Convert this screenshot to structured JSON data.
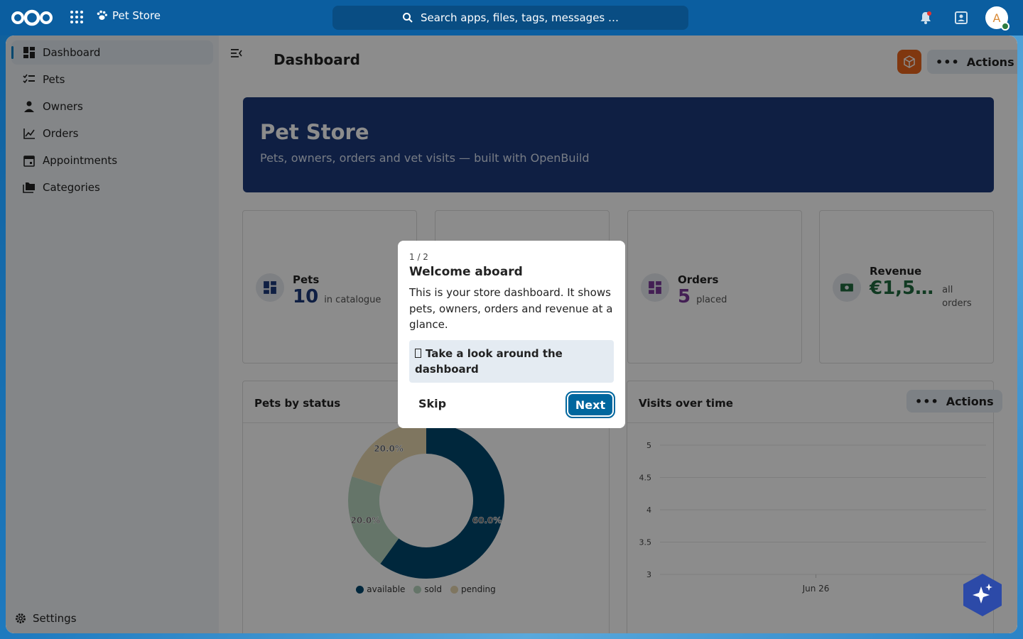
{
  "header": {
    "app_name": "Pet Store",
    "search_placeholder": "Search apps, files, tags, messages …",
    "avatar_initial": "A"
  },
  "sidebar": {
    "items": [
      {
        "label": "Dashboard",
        "icon": "dashboard-icon",
        "active": true
      },
      {
        "label": "Pets",
        "icon": "list-check-icon"
      },
      {
        "label": "Owners",
        "icon": "person-icon"
      },
      {
        "label": "Orders",
        "icon": "chart-line-icon"
      },
      {
        "label": "Appointments",
        "icon": "calendar-icon"
      },
      {
        "label": "Categories",
        "icon": "folders-icon"
      }
    ],
    "settings_label": "Settings"
  },
  "main": {
    "title": "Dashboard",
    "actions_label": "Actions",
    "hero": {
      "title": "Pet Store",
      "subtitle": "Pets, owners, orders and vet visits — built with OpenBuild"
    },
    "stats": [
      {
        "label": "Pets",
        "value": "10",
        "unit": "in catalogue",
        "color": "#1d3a7a"
      },
      {
        "label": "Orders",
        "value": "5",
        "unit": "placed",
        "color": "#7a3a9a"
      },
      {
        "label": "Revenue",
        "value": "€1,5…",
        "unit": "all orders",
        "color": "#1f6b3f"
      }
    ],
    "panels": {
      "pets_status_title": "Pets by status",
      "visits_title": "Visits over time",
      "visits_actions": "Actions"
    }
  },
  "chart_data": [
    {
      "type": "pie",
      "title": "Pets by status",
      "categories": [
        "available",
        "sold",
        "pending"
      ],
      "values": [
        60.0,
        20.0,
        20.0
      ],
      "data_labels": [
        "60.0%",
        "20.0%",
        "20.0%"
      ],
      "colors": [
        "#00476e",
        "#b8d6c0",
        "#e8d8b0"
      ],
      "legend": "bottom"
    },
    {
      "type": "line",
      "title": "Visits over time",
      "x": [
        "Jun 26"
      ],
      "yticks": [
        "5",
        "4.5",
        "4",
        "3.5",
        "3"
      ],
      "ylim": [
        3,
        5
      ]
    }
  ],
  "tour": {
    "step": "1 / 2",
    "title": "Welcome aboard",
    "body": "This is your store dashboard. It shows pets, owners, orders and revenue at a glance.",
    "hint": "Take a look around the dashboard",
    "skip_label": "Skip",
    "next_label": "Next"
  }
}
